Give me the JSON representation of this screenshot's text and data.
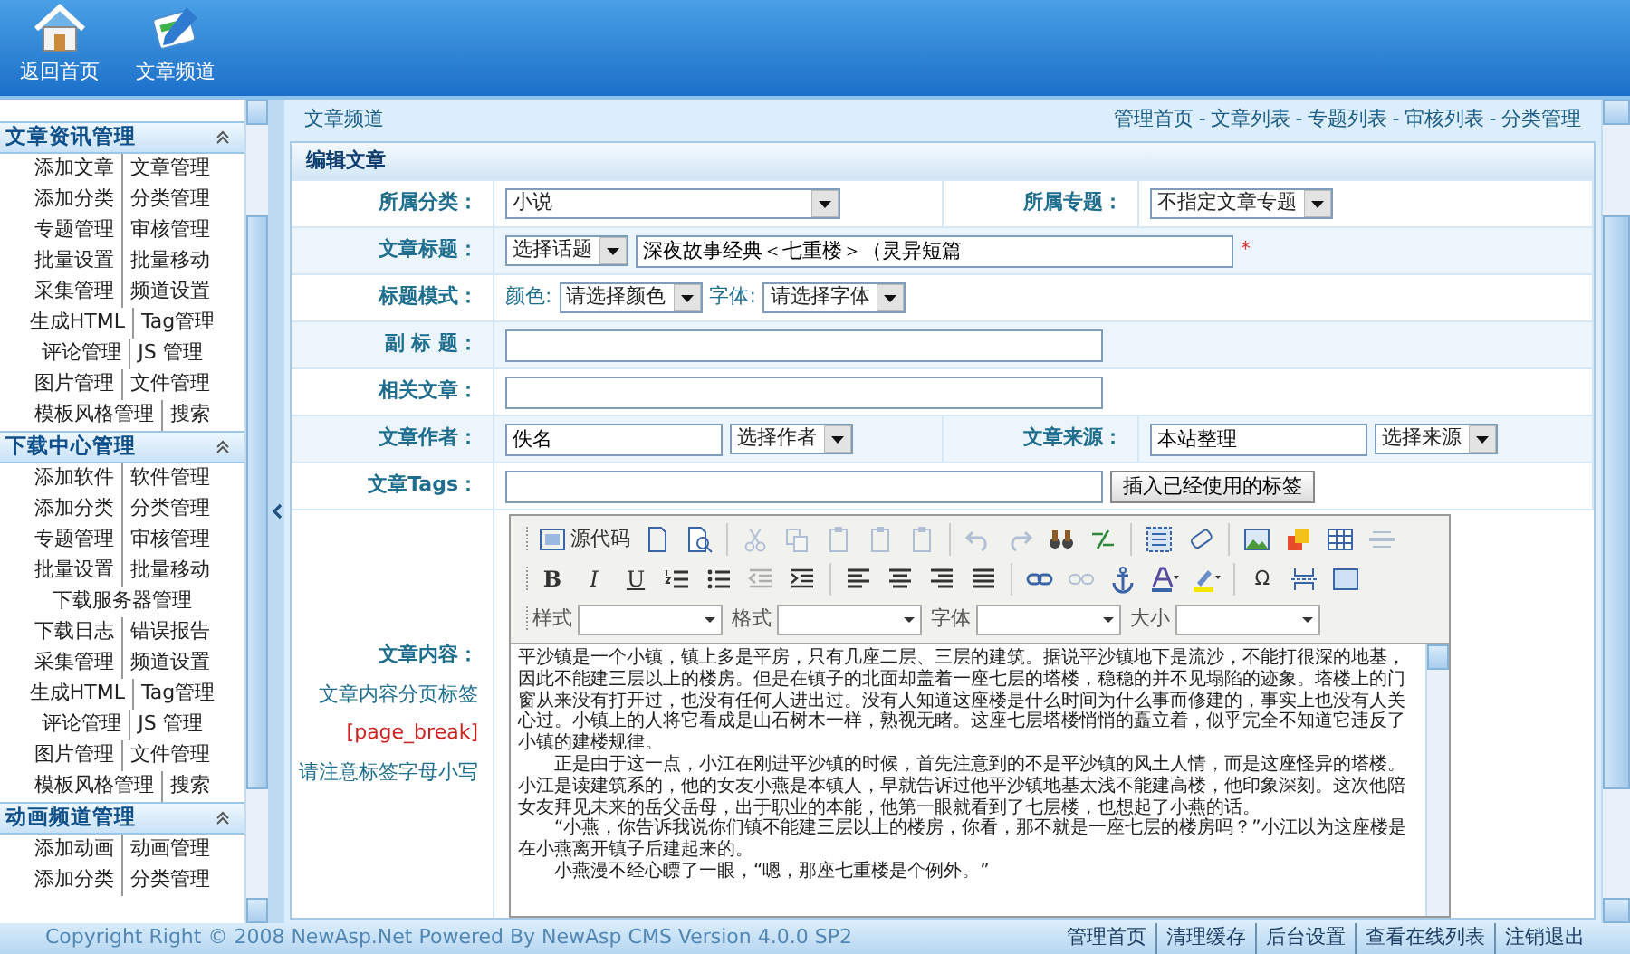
{
  "top_nav": [
    {
      "label": "返回首页",
      "kind": "home"
    },
    {
      "label": "文章频道",
      "kind": "channel"
    }
  ],
  "sidebar": {
    "sections": [
      {
        "title": "文章资讯管理",
        "expanded": true,
        "rows": [
          [
            "添加文章",
            "文章管理"
          ],
          [
            "添加分类",
            "分类管理"
          ],
          [
            "专题管理",
            "审核管理"
          ],
          [
            "批量设置",
            "批量移动"
          ],
          [
            "采集管理",
            "频道设置"
          ],
          [
            "生成HTML",
            "Tag管理"
          ],
          [
            "评论管理",
            "JS 管理"
          ],
          [
            "图片管理",
            "文件管理"
          ],
          [
            "模板风格管理",
            "搜索"
          ]
        ]
      },
      {
        "title": "下载中心管理",
        "expanded": true,
        "rows": [
          [
            "添加软件",
            "软件管理"
          ],
          [
            "添加分类",
            "分类管理"
          ],
          [
            "专题管理",
            "审核管理"
          ],
          [
            "批量设置",
            "批量移动"
          ],
          [
            "下载服务器管理"
          ],
          [
            "下载日志",
            "错误报告"
          ],
          [
            "采集管理",
            "频道设置"
          ],
          [
            "生成HTML",
            "Tag管理"
          ],
          [
            "评论管理",
            "JS 管理"
          ],
          [
            "图片管理",
            "文件管理"
          ],
          [
            "模板风格管理",
            "搜索"
          ]
        ]
      },
      {
        "title": "动画频道管理",
        "expanded": true,
        "rows": [
          [
            "添加动画",
            "动画管理"
          ],
          [
            "添加分类",
            "分类管理"
          ]
        ]
      }
    ]
  },
  "main": {
    "title": "文章频道",
    "links": [
      "管理首页",
      "文章列表",
      "专题列表",
      "审核列表",
      "分类管理"
    ],
    "link_separator": "-",
    "form": {
      "title": "编辑文章",
      "rows": [
        {
          "label": "所属分类：",
          "cells": [
            {
              "kind": "select",
              "value": "小说"
            }
          ],
          "label2": "所属专题：",
          "cells2": [
            {
              "kind": "select",
              "value": "不指定文章专题"
            }
          ]
        },
        {
          "label": "文章标题：",
          "cells": [
            {
              "kind": "select",
              "value": "选择话题"
            },
            {
              "kind": "input",
              "value": "深夜故事经典＜七重楼＞（灵异短篇"
            },
            {
              "kind": "required",
              "text": "*"
            }
          ]
        },
        {
          "label": "标题模式：",
          "cells": [
            {
              "kind": "text",
              "text": "颜色:"
            },
            {
              "kind": "select",
              "value": "请选择颜色"
            },
            {
              "kind": "text",
              "text": "字体:"
            },
            {
              "kind": "select",
              "value": "请选择字体"
            }
          ]
        },
        {
          "label": "副 标 题：",
          "cells": [
            {
              "kind": "input"
            }
          ]
        },
        {
          "label": "相关文章：",
          "cells": [
            {
              "kind": "input"
            }
          ]
        },
        {
          "label": "文章作者：",
          "cells": [
            {
              "kind": "input",
              "value": "佚名"
            },
            {
              "kind": "select",
              "value": "选择作者"
            }
          ],
          "label2": "文章来源：",
          "cells2": [
            {
              "kind": "input",
              "value": "本站整理"
            },
            {
              "kind": "select",
              "value": "选择来源"
            }
          ]
        },
        {
          "label": "文章Tags：",
          "cells": [
            {
              "kind": "input"
            },
            {
              "kind": "button",
              "label": "插入已经使用的标签"
            }
          ]
        }
      ],
      "editor": {
        "label": "文章内容：",
        "notes": [
          {
            "kind": "hint",
            "text": "文章内容分页标签"
          },
          {
            "kind": "code",
            "text": "[page_break]"
          },
          {
            "kind": "hint",
            "text": "请注意标签字母小写"
          }
        ],
        "toolbar": [
          [
            {
              "kind": "source",
              "label": "源代码",
              "disabled": false
            },
            {
              "kind": "newpage",
              "disabled": false
            },
            {
              "kind": "preview",
              "disabled": false
            },
            {
              "kind": "sep"
            },
            {
              "kind": "cut",
              "disabled": true
            },
            {
              "kind": "copy",
              "disabled": true
            },
            {
              "kind": "paste",
              "disabled": true
            },
            {
              "kind": "paste",
              "disabled": true
            },
            {
              "kind": "paste",
              "disabled": true
            },
            {
              "kind": "sep"
            },
            {
              "kind": "undo",
              "disabled": true
            },
            {
              "kind": "redo",
              "disabled": true
            },
            {
              "kind": "find",
              "disabled": false
            },
            {
              "kind": "replace",
              "disabled": false
            },
            {
              "kind": "sep"
            },
            {
              "kind": "selectall",
              "disabled": false
            },
            {
              "kind": "eraser",
              "disabled": false
            },
            {
              "kind": "sep"
            },
            {
              "kind": "image",
              "disabled": false
            },
            {
              "kind": "flash",
              "disabled": false
            },
            {
              "kind": "table",
              "disabled": false
            },
            {
              "kind": "rule",
              "disabled": true
            }
          ],
          [
            {
              "kind": "bold",
              "label": "B",
              "disabled": false
            },
            {
              "kind": "italic",
              "label": "I",
              "disabled": false
            },
            {
              "kind": "underline",
              "label": "U",
              "disabled": false
            },
            {
              "kind": "ol",
              "disabled": false
            },
            {
              "kind": "ul",
              "disabled": false
            },
            {
              "kind": "outdent",
              "disabled": true
            },
            {
              "kind": "indent",
              "disabled": false
            },
            {
              "kind": "sep"
            },
            {
              "kind": "left",
              "disabled": false
            },
            {
              "kind": "center",
              "disabled": false
            },
            {
              "kind": "right",
              "disabled": false
            },
            {
              "kind": "justify",
              "disabled": false
            },
            {
              "kind": "sep"
            },
            {
              "kind": "link",
              "disabled": false
            },
            {
              "kind": "unlink",
              "disabled": true
            },
            {
              "kind": "anchor",
              "disabled": false
            },
            {
              "kind": "textcolor",
              "disabled": false
            },
            {
              "kind": "bgcolor",
              "disabled": false
            },
            {
              "kind": "sep"
            },
            {
              "kind": "special",
              "label": "Ω",
              "disabled": false
            },
            {
              "kind": "pagebreak",
              "disabled": false
            },
            {
              "kind": "maximize",
              "disabled": false
            }
          ]
        ],
        "combos": [
          {
            "label": "样式"
          },
          {
            "label": "格式"
          },
          {
            "label": "字体"
          },
          {
            "label": "大小"
          }
        ],
        "paragraphs": [
          {
            "text": "平沙镇是一个小镇，镇上多是平房，只有几座二层、三层的建筑。据说平沙镇地下是流沙，不能打很深的地基，因此不能建三层以上的楼房。但是在镇子的北面却盖着一座七层的塔楼，稳稳的并不见塌陷的迹象。塔楼上的门窗从来没有打开过，也没有任何人进出过。没有人知道这座楼是什么时间为什么事而修建的，事实上也没有人关心过。小镇上的人将它看成是山石树木一样，熟视无睹。这座七层塔楼悄悄的矗立着，似乎完全不知道它违反了小镇的建楼规律。",
            "indent": false
          },
          {
            "text": "正是由于这一点，小江在刚进平沙镇的时候，首先注意到的不是平沙镇的风土人情，而是这座怪异的塔楼。小江是读建筑系的，他的女友小燕是本镇人，早就告诉过他平沙镇地基太浅不能建高楼，他印象深刻。这次他陪女友拜见未来的岳父岳母，出于职业的本能，他第一眼就看到了七层楼，也想起了小燕的话。",
            "indent": true
          },
          {
            "text": "“小燕，你告诉我说你们镇不能建三层以上的楼房，你看，那不就是一座七层的楼房吗？”小江以为这座楼是在小燕离开镇子后建起来的。",
            "indent": true
          },
          {
            "text": "小燕漫不经心瞟了一眼，“嗯，那座七重楼是个例外。”",
            "indent": true
          }
        ]
      }
    }
  },
  "footer": {
    "copyright": "Copyright Right © 2008 NewAsp.Net Powered By NewAsp CMS Version 4.0.0 SP2",
    "links": [
      "管理首页",
      "清理缓存",
      "后台设置",
      "查看在线列表",
      "注销退出"
    ]
  }
}
